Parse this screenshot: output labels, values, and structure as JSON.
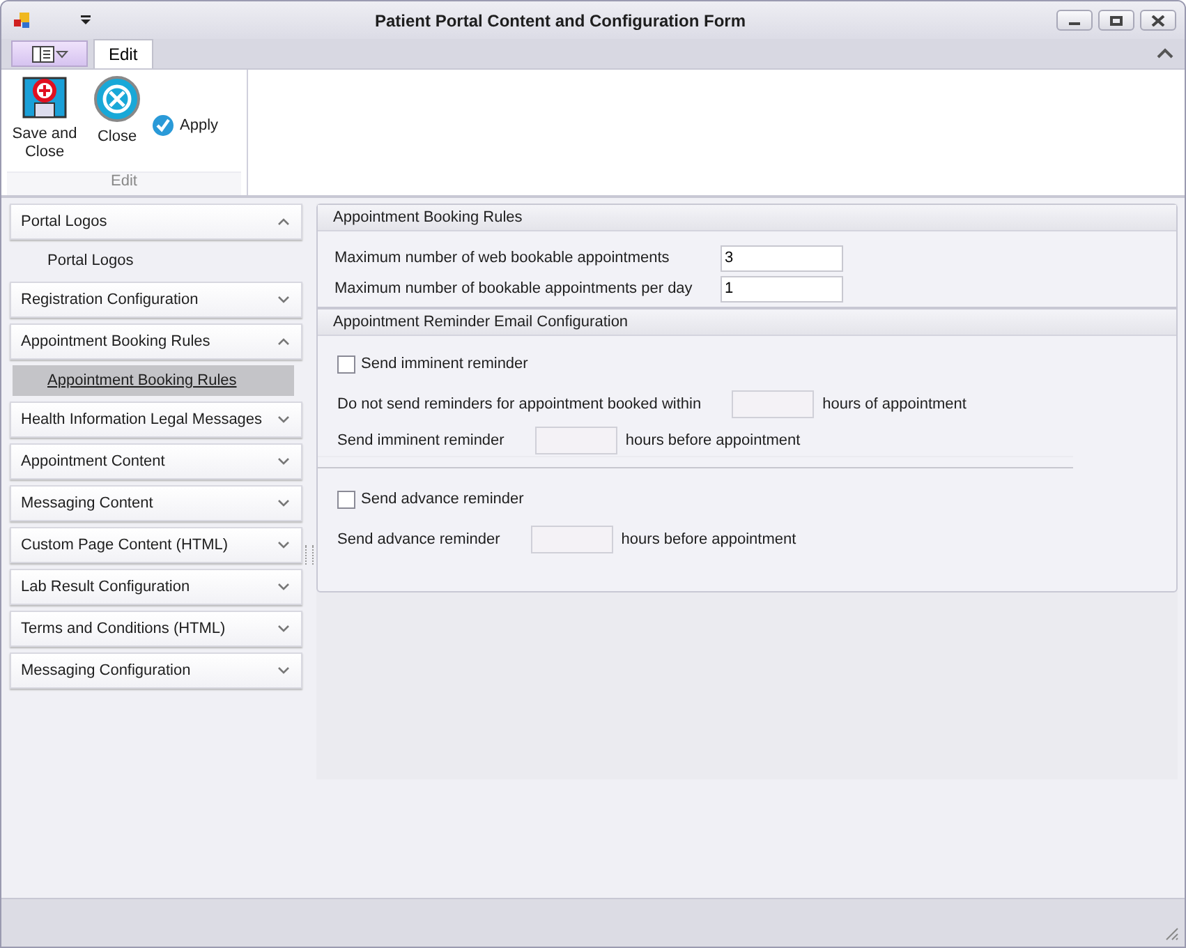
{
  "window": {
    "title": "Patient Portal Content and Configuration Form"
  },
  "ribbon": {
    "tabs": [
      {
        "label": "Edit",
        "selected": true
      }
    ],
    "groups": [
      {
        "label": "Edit",
        "buttons": [
          {
            "label": "Save and Close",
            "kind": "save"
          },
          {
            "label": "Close",
            "kind": "close"
          },
          {
            "label": "Apply",
            "kind": "apply"
          }
        ]
      }
    ]
  },
  "nav": {
    "sections": [
      {
        "label": "Portal Logos",
        "expanded": true,
        "children": [
          {
            "label": "Portal Logos",
            "selected": false
          }
        ]
      },
      {
        "label": "Registration Configuration",
        "expanded": false
      },
      {
        "label": "Appointment Booking Rules",
        "expanded": true,
        "children": [
          {
            "label": "Appointment Booking Rules",
            "selected": true
          }
        ]
      },
      {
        "label": "Health Information Legal Messages",
        "expanded": false
      },
      {
        "label": "Appointment Content",
        "expanded": false
      },
      {
        "label": "Messaging Content",
        "expanded": false
      },
      {
        "label": "Custom Page Content (HTML)",
        "expanded": false
      },
      {
        "label": "Lab Result Configuration",
        "expanded": false
      },
      {
        "label": "Terms and Conditions (HTML)",
        "expanded": false
      },
      {
        "label": "Messaging Configuration",
        "expanded": false
      }
    ]
  },
  "booking_rules": {
    "title": "Appointment Booking Rules",
    "fields": [
      {
        "label": "Maximum number of web bookable appointments",
        "value": "3"
      },
      {
        "label": "Maximum number of bookable appointments per day",
        "value": "1"
      }
    ]
  },
  "reminders": {
    "title": "Appointment Reminder Email Configuration",
    "groups": [
      {
        "checkbox": {
          "label": "Send imminent reminder",
          "checked": false
        },
        "rows": [
          {
            "label": "Do not send reminders for appointment booked within",
            "suffix": "hours of appointment"
          },
          {
            "label": "Send imminent reminder",
            "suffix": "hours before appointment"
          }
        ]
      },
      {
        "checkbox": {
          "label": "Send advance reminder",
          "checked": false
        },
        "rows": [
          {
            "label": "Send advance reminder",
            "suffix": "hours before appointment"
          }
        ]
      }
    ]
  }
}
